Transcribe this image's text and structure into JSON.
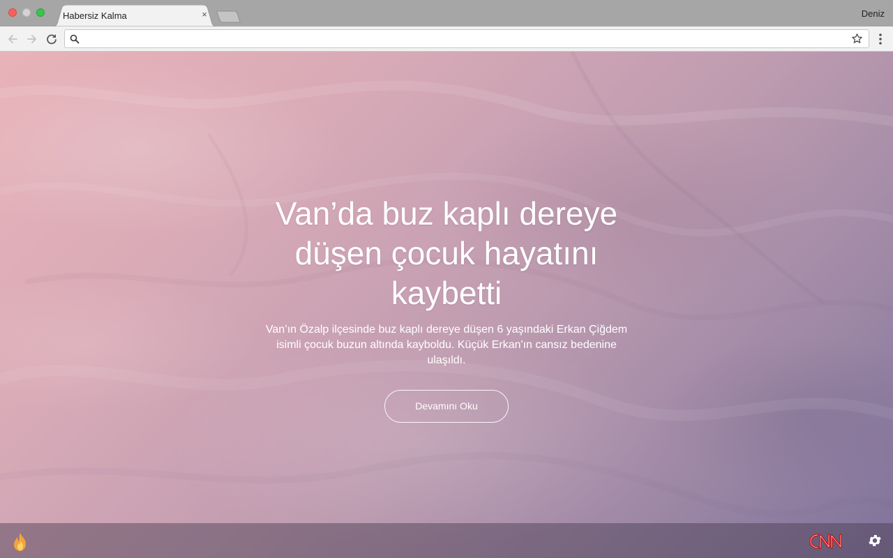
{
  "browser": {
    "tab_title": "Habersiz Kalma",
    "tab_close_glyph": "×",
    "profile_name": "Deniz",
    "address_value": "",
    "address_placeholder": "",
    "icons": [
      "back-arrow-icon",
      "forward-arrow-icon",
      "reload-icon",
      "search-icon",
      "bookmark-star-icon",
      "menu-dots-icon"
    ]
  },
  "article": {
    "headline": "Van’da buz kaplı dereye düşen çocuk hayatını kaybetti",
    "summary": "Van’ın Özalp ilçesinde buz kaplı dereye düşen 6 yaşındaki Erkan Çiğdem isimli çocuk buzun altında kayboldu. Küçük Erkan'ın cansız bedenine ulaşıldı.",
    "read_more_label": "Devamını Oku"
  },
  "footer": {
    "left_icon": "fire-icon",
    "source_logo": "CNN",
    "right_icon": "gear-icon"
  },
  "colors": {
    "bg_top_left": "#e8b3b8",
    "bg_bottom_right": "#7f729a",
    "cnn_red": "#cc0000",
    "text": "#ffffff"
  }
}
